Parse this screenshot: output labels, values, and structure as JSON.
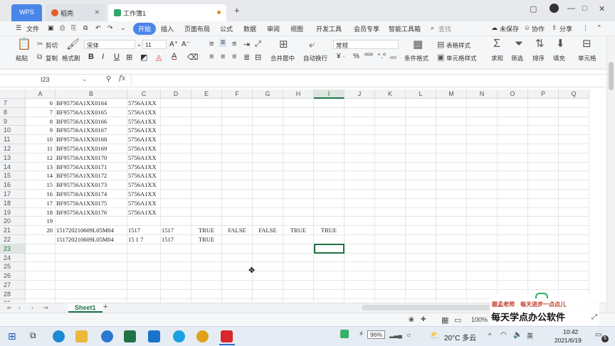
{
  "tabs": {
    "wps": "WPS",
    "daoke": "稻壳",
    "workbook": "工作簿1",
    "new_tab": "+"
  },
  "window_controls": {
    "restore": "▢",
    "minimize": "—",
    "maximize": "□",
    "close": "✕"
  },
  "menu": {
    "file": "文件",
    "items": [
      "开始",
      "插入",
      "页面布局",
      "公式",
      "数据",
      "审阅",
      "视图",
      "开发工具",
      "会员专享",
      "智能工具箱"
    ],
    "search": "查找",
    "unsaved": "未保存",
    "collab": "协作",
    "share": "分享"
  },
  "ribbon": {
    "paste": "粘贴",
    "cut": "剪切",
    "copy": "复制",
    "format_painter": "格式刷",
    "font": "宋体",
    "font_size": "11",
    "bold": "B",
    "italic": "I",
    "underline": "U",
    "merge": "合并居中",
    "wrap": "自动换行",
    "number_format": "常规",
    "table_style": "表格样式",
    "cond_format": "条件格式",
    "cell_style": "单元格样式",
    "sum": "求和",
    "filter": "筛选",
    "sort": "排序",
    "fill": "填充",
    "cells": "单元格"
  },
  "formula_bar": {
    "name_box": "I23",
    "fx": "fx",
    "value": ""
  },
  "columns": [
    "A",
    "B",
    "C",
    "D",
    "E",
    "F",
    "G",
    "H",
    "I",
    "J",
    "K",
    "L",
    "M",
    "N",
    "O",
    "P",
    "Q"
  ],
  "selected_column": "I",
  "selected_row": "23",
  "rows": [
    {
      "r": "7",
      "A": "6",
      "B": "BF95756A1XX0164",
      "C": "5756A1XX"
    },
    {
      "r": "8",
      "A": "7",
      "B": "BF95756A1XX0165",
      "C": "5756A1XX"
    },
    {
      "r": "9",
      "A": "8",
      "B": "BF95756A1XX0166",
      "C": "5756A1XX"
    },
    {
      "r": "10",
      "A": "9",
      "B": "BF95756A1XX0167",
      "C": "5756A1XX"
    },
    {
      "r": "11",
      "A": "10",
      "B": "BF95756A1XX0168",
      "C": "5756A1XX"
    },
    {
      "r": "12",
      "A": "11",
      "B": "BF95756A1XX0169",
      "C": "5756A1XX"
    },
    {
      "r": "13",
      "A": "12",
      "B": "BF95756A1XX0170",
      "C": "5756A1XX"
    },
    {
      "r": "14",
      "A": "13",
      "B": "BF95756A1XX0171",
      "C": "5756A1XX"
    },
    {
      "r": "15",
      "A": "14",
      "B": "BF95756A1XX0172",
      "C": "5756A1XX"
    },
    {
      "r": "16",
      "A": "15",
      "B": "BF95756A1XX0173",
      "C": "5756A1XX"
    },
    {
      "r": "17",
      "A": "16",
      "B": "BF95756A1XX0174",
      "C": "5756A1XX"
    },
    {
      "r": "18",
      "A": "17",
      "B": "BF95756A1XX0175",
      "C": "5756A1XX"
    },
    {
      "r": "19",
      "A": "18",
      "B": "BF95756A1XX0176",
      "C": "5756A1XX"
    },
    {
      "r": "20",
      "A": "19"
    },
    {
      "r": "21",
      "A": "20",
      "B": "151720210609L05M04",
      "C": "1517",
      "D": "1517",
      "E": "TRUE",
      "F": "FALSE",
      "G": "FALSE",
      "H": "TRUE",
      "I": "TRUE"
    },
    {
      "r": "22",
      "B": "151720210609L05M04",
      "C": "15 1 7",
      "D": "1517",
      "E": "TRUE"
    },
    {
      "r": "23"
    },
    {
      "r": "24"
    },
    {
      "r": "25"
    },
    {
      "r": "26"
    },
    {
      "r": "27"
    },
    {
      "r": "28"
    },
    {
      "r": "29"
    }
  ],
  "sheet_tab": "Sheet1",
  "status": {
    "zoom": "100%"
  },
  "watermark": {
    "line1": "跟孟老师　每天进步一点点儿",
    "line2": "每天学点办公软件"
  },
  "taskbar": {
    "battery": "96%",
    "weather": "20°C 多云",
    "time": "10:42",
    "date": "2021/6/19",
    "notifications": "5"
  },
  "colors": {
    "accent": "#4a86e8",
    "excel_green": "#217346",
    "selection": "#1e7145"
  }
}
